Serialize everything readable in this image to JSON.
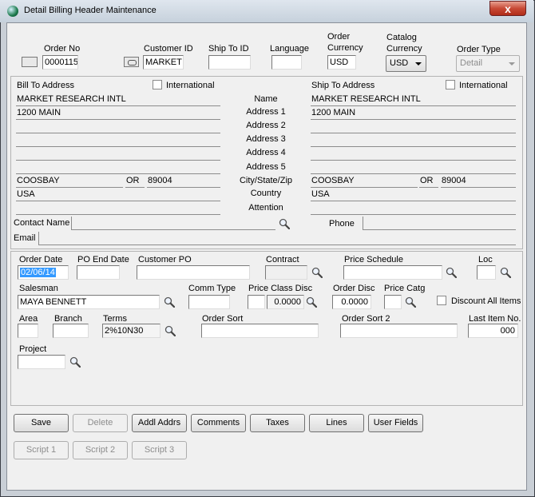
{
  "window": {
    "title": "Detail Billing Header Maintenance",
    "close": "x"
  },
  "header": {
    "order_no_label": "Order No",
    "order_no": "0000115",
    "customer_id_label": "Customer ID",
    "customer_id": "MARKET",
    "ship_to_id_label": "Ship To ID",
    "ship_to_id": "",
    "language_label": "Language",
    "language": "",
    "order_currency_label_1": "Order",
    "order_currency_label_2": "Currency",
    "order_currency": "USD",
    "catalog_currency_label_1": "Catalog",
    "catalog_currency_label_2": "Currency",
    "catalog_currency": "USD",
    "order_type_label": "Order Type",
    "order_type": "Detail"
  },
  "address": {
    "bill_to_label": "Bill To Address",
    "ship_to_label": "Ship To Address",
    "international_label": "International",
    "row_labels": [
      "Name",
      "Address 1",
      "Address 2",
      "Address 3",
      "Address 4",
      "Address 5",
      "City/State/Zip",
      "Country",
      "Attention"
    ],
    "bill": {
      "name": "MARKET RESEARCH INTL",
      "address1": "1200 MAIN",
      "address2": "",
      "address3": "",
      "address4": "",
      "address5": "",
      "city": "COOSBAY",
      "state": "OR",
      "zip": "89004",
      "country": "USA",
      "attention": ""
    },
    "ship": {
      "name": "MARKET RESEARCH INTL",
      "address1": "1200 MAIN",
      "address2": "",
      "address3": "",
      "address4": "",
      "address5": "",
      "city": "COOSBAY",
      "state": "OR",
      "zip": "89004",
      "country": "USA",
      "attention": ""
    },
    "contact_name_label": "Contact Name",
    "contact_name": "",
    "phone_label": "Phone",
    "phone": "",
    "email_label": "Email",
    "email": ""
  },
  "order": {
    "order_date_label": "Order Date",
    "order_date": "02/06/14",
    "po_end_date_label": "PO End Date",
    "po_end_date": "",
    "customer_po_label": "Customer PO",
    "customer_po": "",
    "contract_label": "Contract",
    "contract": "",
    "price_schedule_label": "Price Schedule",
    "price_schedule": "",
    "loc_label": "Loc",
    "loc": "",
    "salesman_label": "Salesman",
    "salesman": "MAYA BENNETT",
    "comm_type_label": "Comm Type",
    "comm_type": "",
    "price_class_disc_label": "Price Class Disc",
    "price_class_disc_code": "",
    "price_class_disc": "0.0000",
    "order_disc_label": "Order Disc",
    "order_disc": "0.0000",
    "price_catg_label": "Price Catg",
    "price_catg": "",
    "discount_all_label": "Discount All Items",
    "area_label": "Area",
    "area": "",
    "branch_label": "Branch",
    "branch": "",
    "terms_label": "Terms",
    "terms": "2%10N30",
    "order_sort_label": "Order Sort",
    "order_sort": "",
    "order_sort2_label": "Order Sort 2",
    "order_sort2": "",
    "last_item_label": "Last Item No.",
    "last_item": "000",
    "project_label": "Project",
    "project": ""
  },
  "buttons": {
    "save": "Save",
    "delete": "Delete",
    "addl_addrs": "Addl Addrs",
    "comments": "Comments",
    "taxes": "Taxes",
    "lines": "Lines",
    "user_fields": "User Fields",
    "script1": "Script 1",
    "script2": "Script 2",
    "script3": "Script 3"
  }
}
